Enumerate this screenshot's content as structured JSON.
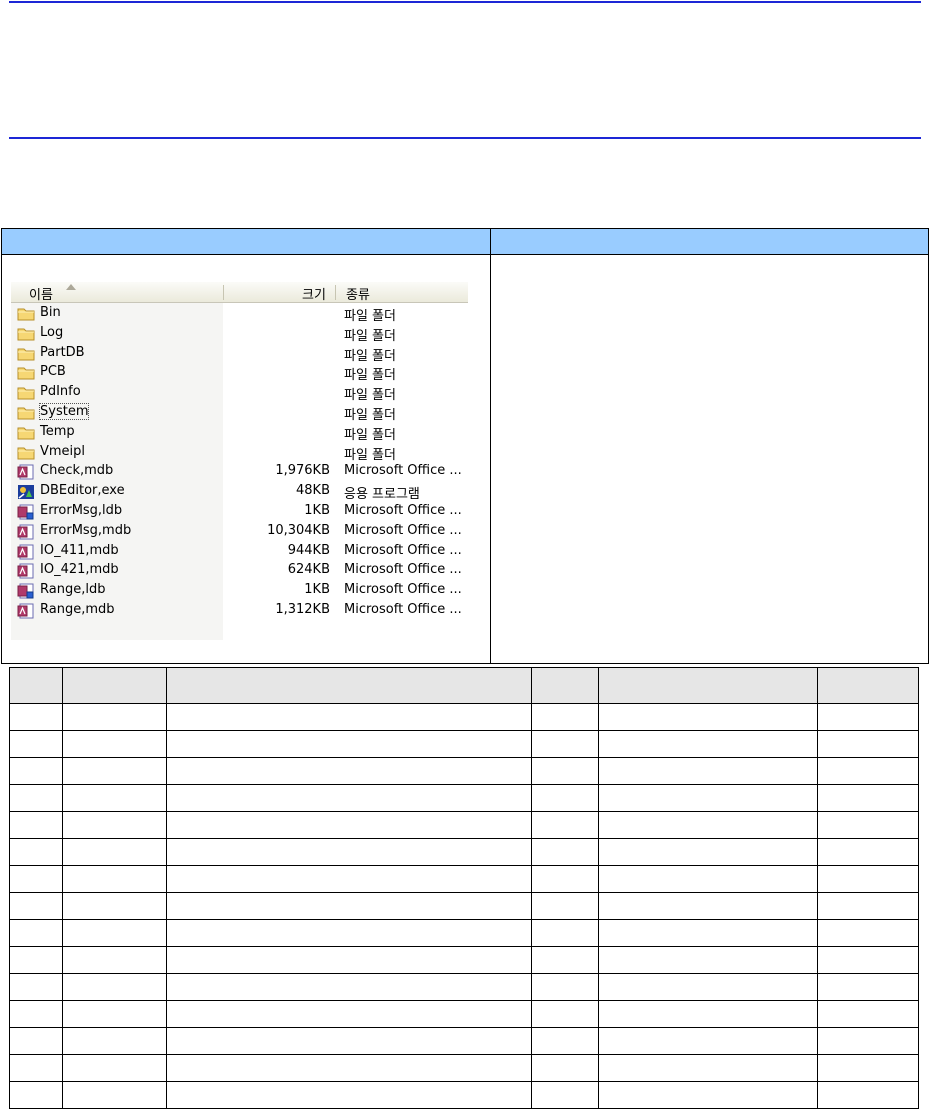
{
  "explorer": {
    "columns": {
      "name": "이름",
      "size": "크기",
      "type": "종류"
    },
    "rows": [
      {
        "name": "Bin",
        "size": "",
        "type": "파일 폴더",
        "icon": "folder-icon"
      },
      {
        "name": "Log",
        "size": "",
        "type": "파일 폴더",
        "icon": "folder-icon"
      },
      {
        "name": "PartDB",
        "size": "",
        "type": "파일 폴더",
        "icon": "folder-icon"
      },
      {
        "name": "PCB",
        "size": "",
        "type": "파일 폴더",
        "icon": "folder-icon"
      },
      {
        "name": "PdInfo",
        "size": "",
        "type": "파일 폴더",
        "icon": "folder-icon"
      },
      {
        "name": "System",
        "size": "",
        "type": "파일 폴더",
        "icon": "folder-icon"
      },
      {
        "name": "Temp",
        "size": "",
        "type": "파일 폴더",
        "icon": "folder-icon"
      },
      {
        "name": "Vmeipl",
        "size": "",
        "type": "파일 폴더",
        "icon": "folder-icon"
      },
      {
        "name": "Check,mdb",
        "size": "1,976KB",
        "type": "Microsoft Office ...",
        "icon": "access-db-icon"
      },
      {
        "name": "DBEditor,exe",
        "size": "48KB",
        "type": "응용 프로그램",
        "icon": "application-icon"
      },
      {
        "name": "ErrorMsg,ldb",
        "size": "1KB",
        "type": "Microsoft Office ...",
        "icon": "access-lock-icon"
      },
      {
        "name": "ErrorMsg,mdb",
        "size": "10,304KB",
        "type": "Microsoft Office ...",
        "icon": "access-db-icon"
      },
      {
        "name": "IO_411,mdb",
        "size": "944KB",
        "type": "Microsoft Office ...",
        "icon": "access-db-icon"
      },
      {
        "name": "IO_421,mdb",
        "size": "624KB",
        "type": "Microsoft Office ...",
        "icon": "access-db-icon"
      },
      {
        "name": "Range,ldb",
        "size": "1KB",
        "type": "Microsoft Office ...",
        "icon": "access-lock-icon"
      },
      {
        "name": "Range,mdb",
        "size": "1,312KB",
        "type": "Microsoft Office ...",
        "icon": "access-db-icon"
      }
    ],
    "focused_row": "System"
  },
  "colors": {
    "rule": "#1d27d6",
    "table_header": "#99ccff",
    "grid_header": "#e6e6e6"
  }
}
